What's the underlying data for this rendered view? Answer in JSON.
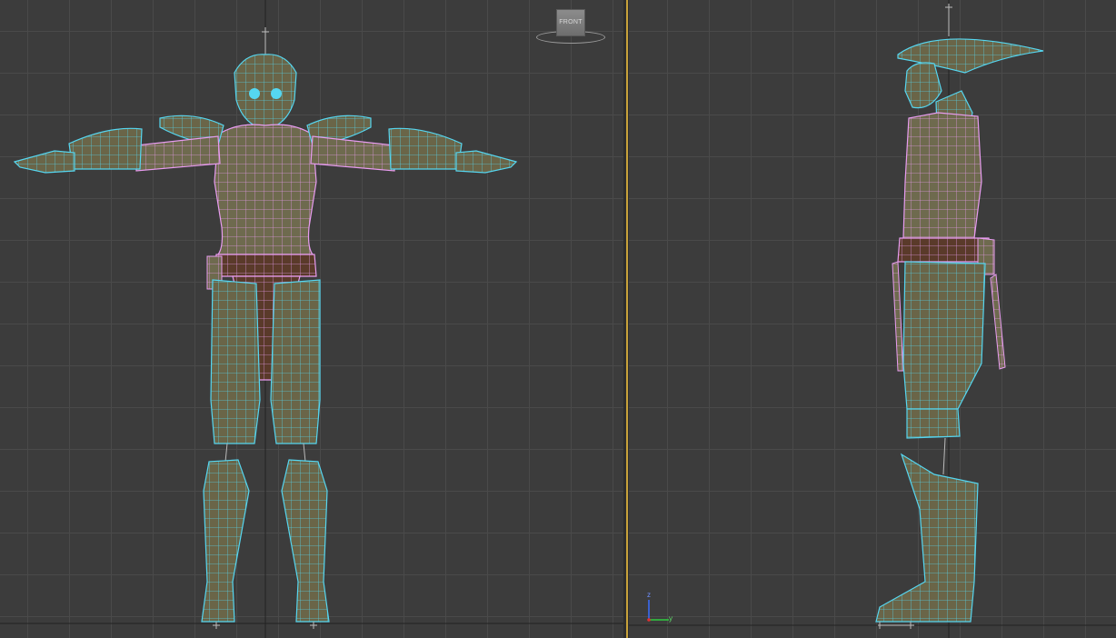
{
  "viewports": {
    "front": {
      "viewcube_label": "FRONT"
    },
    "left": {
      "axis_labels": {
        "vertical": "z",
        "horizontal": "y"
      },
      "axis_colors": {
        "vertical": "#3a6cff",
        "horizontal": "#2ecc40",
        "origin": "#e03030"
      }
    }
  },
  "colors": {
    "wire_cyan": "#55d6f0",
    "wire_pink": "#e89cf0",
    "skin": "#6e6a4e",
    "belt": "#5a3a2a",
    "active_border": "#c8a23a"
  },
  "icons": {
    "viewcube": "viewcube-front-icon",
    "compass": "compass-ring-icon",
    "axis": "axis-tripod-icon"
  }
}
